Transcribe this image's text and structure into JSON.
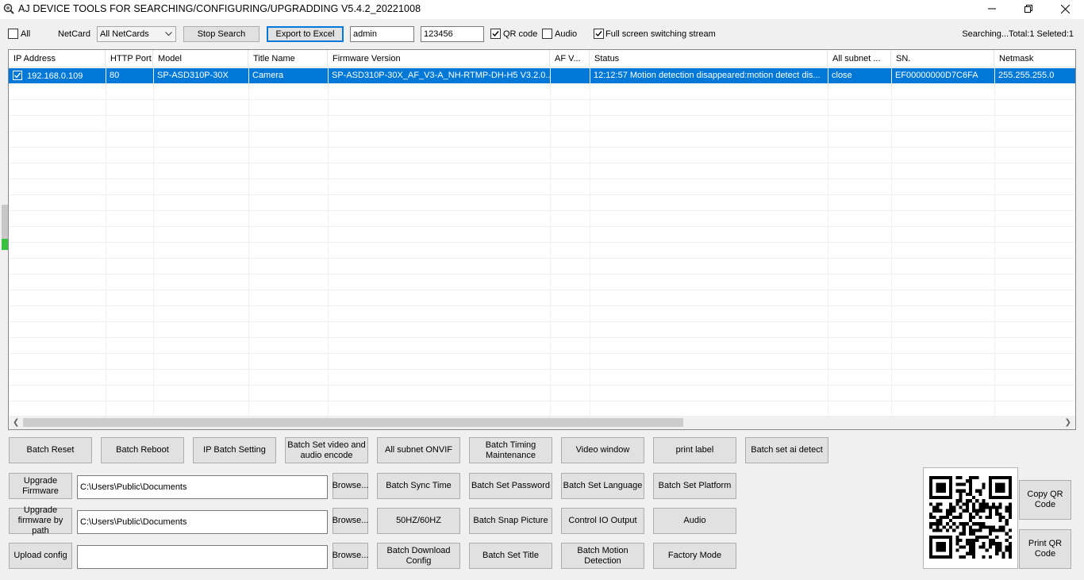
{
  "window": {
    "title": "AJ DEVICE TOOLS FOR SEARCHING/CONFIGURING/UPGRADDING V5.4.2_20221008"
  },
  "toolbar": {
    "all_label": "All",
    "netcard_label": "NetCard",
    "netcard_value": "All NetCards",
    "stop_search": "Stop Search",
    "export_excel": "Export to Excel",
    "username": "admin",
    "password": "123456",
    "qr_code_label": "QR code",
    "qr_code_checked": true,
    "audio_label": "Audio",
    "audio_checked": false,
    "fullscreen_label": "Full screen switching stream",
    "fullscreen_checked": true,
    "status": "Searching...Total:1 Seleted:1"
  },
  "table": {
    "columns": [
      "IP Address",
      "HTTP Port",
      "Model",
      "Title Name",
      "Firmware Version",
      "AF V...",
      "Status",
      "All subnet ...",
      "SN.",
      "Netmask"
    ],
    "rows": [
      {
        "checked": true,
        "selected": true,
        "cells": [
          "192.168.0.109",
          "80",
          "SP-ASD310P-30X",
          "Camera",
          "SP-ASD310P-30X_AF_V3-A_NH-RTMP-DH-H5 V3.2.0....",
          "",
          "12:12:57 Motion detection disappeared:motion detect dis...",
          "close",
          "EF00000000D7C6FA",
          "255.255.255.0"
        ]
      }
    ]
  },
  "progress": {
    "fill_fraction": 0.25,
    "color": "#37c23f"
  },
  "actions": {
    "row1": [
      "Batch Reset",
      "Batch Reboot",
      "IP Batch Setting",
      "Batch Set video and audio encode",
      "All subnet ONVIF",
      "Batch Timing Maintenance",
      "Video window",
      "print label",
      "Batch set ai detect"
    ],
    "upgrade_firmware": "Upgrade Firmware",
    "upgrade_firmware_path": "C:\\Users\\Public\\Documents",
    "upgrade_by_path": "Upgrade firmware by path",
    "upgrade_by_path_path": "C:\\Users\\Public\\Documents",
    "upload_config": "Upload config",
    "upload_config_path": "",
    "browse": "Browse...",
    "row2": [
      "Batch Sync Time",
      "Batch Set Password",
      "Batch Set Language",
      "Batch Set Platform"
    ],
    "row3": [
      "50HZ/60HZ",
      "Batch Snap Picture",
      "Control IO Output",
      "Audio"
    ],
    "row4": [
      "Batch Download Config",
      "Batch Set Title",
      "Batch Motion Detection",
      "Factory Mode"
    ],
    "copy_qr": "Copy QR Code",
    "print_qr": "Print QR Code"
  }
}
